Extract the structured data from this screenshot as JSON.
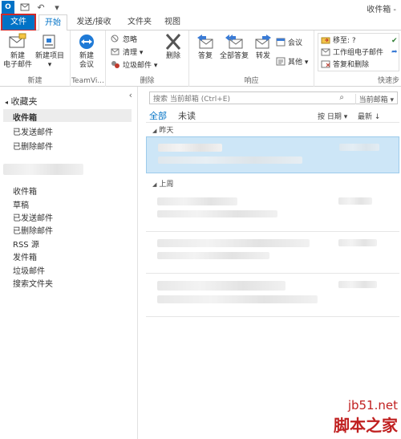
{
  "titlebar": {
    "logo": "O",
    "window_title": "收件箱 -"
  },
  "tabs": {
    "file": "文件",
    "home": "开始",
    "send_receive": "发送/接收",
    "folder": "文件夹",
    "view": "视图"
  },
  "ribbon": {
    "new_email": [
      "新建",
      "电子邮件"
    ],
    "new_items": [
      "新建项目",
      "▾"
    ],
    "group_new": "新建",
    "teamviewer_meeting": [
      "新建",
      "会议"
    ],
    "group_teamviewer": "TeamVi...",
    "ignore": "忽略",
    "cleanup": "清理 ▾",
    "junk": "垃圾邮件 ▾",
    "delete": "删除",
    "group_delete": "删除",
    "reply": "答复",
    "reply_all": "全部答复",
    "forward": "转发",
    "meeting": "会议",
    "more": "其他 ▾",
    "group_respond": "响应",
    "quick_move": "移至: ?",
    "quick_team": "工作组电子邮件",
    "quick_reply_delete": "答复和删除",
    "group_quick": "快速步"
  },
  "nav": {
    "favorites": "收藏夹",
    "fav_items": [
      "收件箱",
      "已发送邮件",
      "已删除邮件"
    ],
    "folders": [
      "收件箱",
      "草稿",
      "已发送邮件",
      "已删除邮件",
      "RSS 源",
      "发件箱",
      "垃圾邮件",
      "搜索文件夹"
    ]
  },
  "list": {
    "search_placeholder": "搜索 当前邮箱 (Ctrl+E)",
    "search_scope": "当前邮箱 ▾",
    "filter_all": "全部",
    "filter_unread": "未读",
    "sort_by": "按 日期 ▾",
    "sort_order": "最新 ↓",
    "group_yesterday": "昨天",
    "group_last_week": "上周"
  },
  "watermark": {
    "url": "jb51.net",
    "name": "脚本之家"
  },
  "colors": {
    "accent": "#0072c6",
    "selection": "#cde6f7",
    "highlight_border": "#d12a2a"
  }
}
